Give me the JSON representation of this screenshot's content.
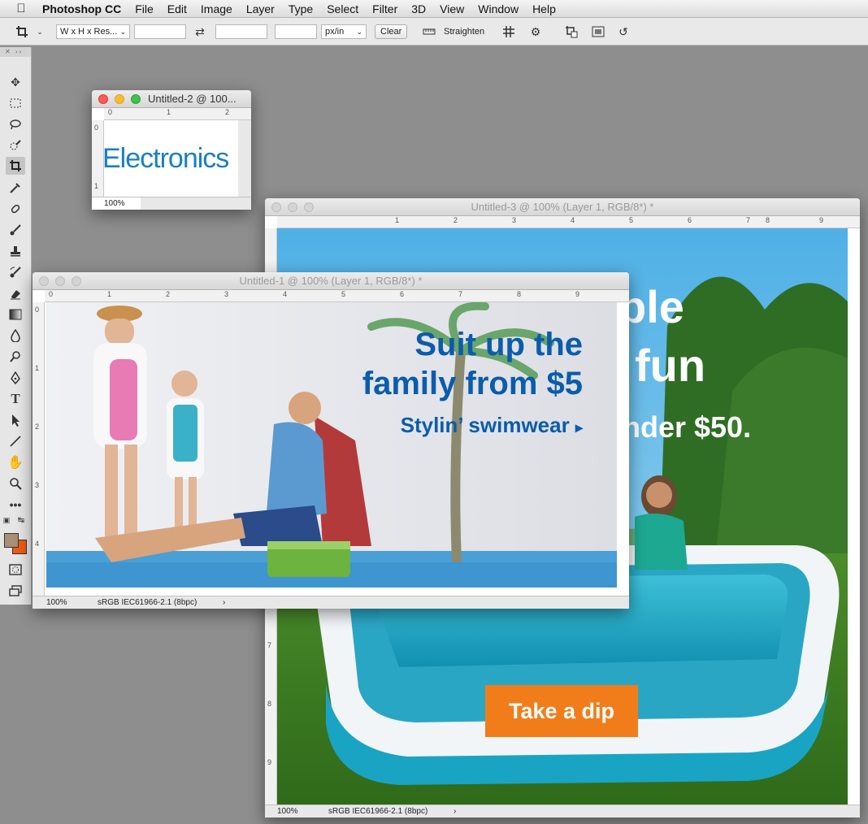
{
  "menubar": {
    "app_name": "Photoshop CC",
    "items": [
      "File",
      "Edit",
      "Image",
      "Layer",
      "Type",
      "Select",
      "Filter",
      "3D",
      "View",
      "Window",
      "Help"
    ]
  },
  "options_bar": {
    "ratio_select": "W x H x Res...",
    "unit_select": "px/in",
    "clear_label": "Clear",
    "straighten_label": "Straighten"
  },
  "windows": {
    "w2": {
      "title": "Untitled-2 @ 100...",
      "zoom": "100%",
      "text": "Electronics",
      "ruler_h": [
        "0",
        "1",
        "2"
      ],
      "ruler_v": [
        "0",
        "1"
      ]
    },
    "w3": {
      "title": "Untitled-3 @ 100% (Layer 1, RGB/8*) *",
      "zoom": "100%",
      "profile": "sRGB IEC61966-2.1 (8bpc)",
      "headline_1": "ble",
      "headline_2": "fun",
      "subline": "nder $50.",
      "button": "Take a dip",
      "ruler_h": [
        "1",
        "2",
        "3",
        "4",
        "5",
        "6",
        "7",
        "8",
        "9"
      ],
      "ruler_v": [
        "7",
        "8",
        "9"
      ]
    },
    "w1": {
      "title": "Untitled-1 @ 100% (Layer 1, RGB/8*) *",
      "zoom": "100%",
      "profile": "sRGB IEC61966-2.1 (8bpc)",
      "headline_1": "Suit up the",
      "headline_2": "family from $5",
      "link": "Stylin’ swimwear",
      "ruler_h": [
        "0",
        "1",
        "2",
        "3",
        "4",
        "5",
        "6",
        "7",
        "8",
        "9"
      ],
      "ruler_v": [
        "0",
        "1",
        "2",
        "3",
        "4"
      ]
    }
  },
  "colors": {
    "brand_blue": "#0b5cab",
    "button_orange": "#f07d1a",
    "foreground": "#a98f77",
    "background": "#f05a14"
  }
}
